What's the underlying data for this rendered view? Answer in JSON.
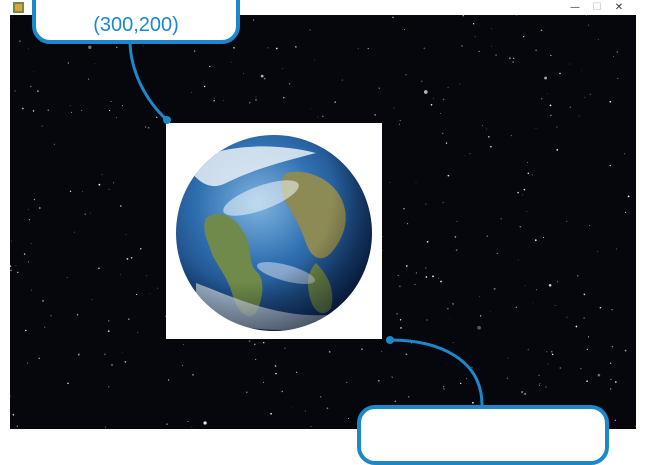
{
  "window": {
    "icon": "app-icon",
    "controls": {
      "minimize": "—",
      "maximize": "☐",
      "close": "✕"
    }
  },
  "scene": {
    "background": "starfield",
    "sprite": "earth-image"
  },
  "callouts": {
    "top_label": "(300,200)",
    "bottom_label": ""
  },
  "colors": {
    "accent": "#1d88c9",
    "space": "#05070c"
  }
}
